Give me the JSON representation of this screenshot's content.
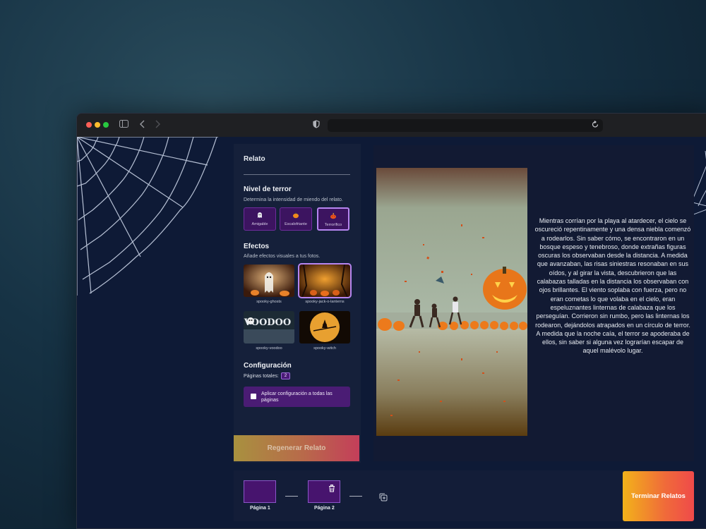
{
  "panel": {
    "title": "Relato",
    "terror": {
      "heading": "Nivel de terror",
      "description": "Determina la intensidad de miendo del relato.",
      "options": [
        {
          "label": "Amigable",
          "icon": "ghost-icon"
        },
        {
          "label": "Escalofriante",
          "icon": "pumpkin-icon"
        },
        {
          "label": "Terrorífico",
          "icon": "flaming-pumpkin-icon"
        }
      ],
      "selected": "Terrorífico"
    },
    "effects": {
      "heading": "Efectos",
      "description": "Añade efectos visuales a tus fotos.",
      "items": [
        {
          "label": "spooky-ghosts"
        },
        {
          "label": "spooky-jack-o-lanterns"
        },
        {
          "label": "spooky-voodoo"
        },
        {
          "label": "spooky-witch"
        }
      ],
      "selected": "spooky-jack-o-lanterns"
    },
    "config": {
      "heading": "Configuración",
      "pages_label": "Páginas totales:",
      "pages_value": "2",
      "apply_label": "Aplicar configuración a todas las páginas"
    },
    "regenerate_label": "Regenerar Relato"
  },
  "preview": {
    "story": "Mientras corrían por la playa al atardecer, el cielo se oscureció repentinamente y una densa niebla comenzó a rodearlos. Sin saber cómo, se encontraron en un bosque espeso y tenebroso, donde extrañas figuras oscuras los observaban desde la distancia. A medida que avanzaban, las risas siniestras resonaban en sus oídos, y al girar la vista, descubrieron que las calabazas talladas en la distancia los observaban con ojos brillantes. El viento soplaba con fuerza, pero no eran cometas lo que volaba en el cielo, eran espeluznantes linternas de calabaza que los perseguían. Corrieron sin rumbo, pero las linternas los rodearon, dejándolos atrapados en un círculo de terror. A medida que la noche caía, el terror se apoderaba de ellos, sin saber si alguna vez lograrían escapar de aquel malévolo lugar."
  },
  "pages": [
    {
      "label": "Página 1"
    },
    {
      "label": "Página 2"
    }
  ],
  "finish_label": "Terminar Relatos",
  "colors": {
    "accent_purple": "#47146e",
    "selected_border": "#b685f0",
    "finish_gradient_start": "#f2b21a",
    "finish_gradient_end": "#ef4a4a"
  }
}
